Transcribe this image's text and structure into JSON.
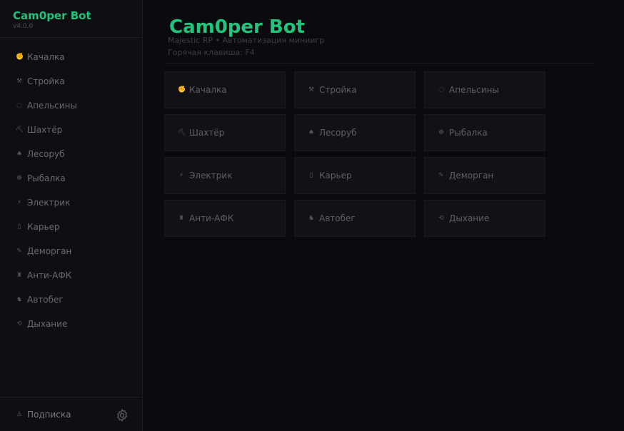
{
  "app": {
    "title": "Cam0per Bot",
    "version": "v4.0.0",
    "accent_color": "#20c47a"
  },
  "sidebar": {
    "items": [
      {
        "label": "Качалка",
        "icon": "muscle-icon",
        "glyph": "✊"
      },
      {
        "label": "Стройка",
        "icon": "hammer-icon",
        "glyph": "⚒"
      },
      {
        "label": "Апельсины",
        "icon": "orange-icon",
        "glyph": "◌"
      },
      {
        "label": "Шахтёр",
        "icon": "pickaxe-icon",
        "glyph": "⛏"
      },
      {
        "label": "Лесоруб",
        "icon": "tree-icon",
        "glyph": "♠"
      },
      {
        "label": "Рыбалка",
        "icon": "fish-icon",
        "glyph": "☸"
      },
      {
        "label": "Электрик",
        "icon": "lightning-icon",
        "glyph": "⚡"
      },
      {
        "label": "Карьер",
        "icon": "quarry-icon",
        "glyph": "▯"
      },
      {
        "label": "Деморган",
        "icon": "pen-icon",
        "glyph": "✎"
      },
      {
        "label": "Анти-АФК",
        "icon": "flask-icon",
        "glyph": "♜"
      },
      {
        "label": "Автобег",
        "icon": "runner-icon",
        "glyph": "♞"
      },
      {
        "label": "Дыхание",
        "icon": "breath-icon",
        "glyph": "⟲"
      }
    ],
    "footer": {
      "subscription_label": "Подписка",
      "subscription_icon": "user-icon",
      "subscription_glyph": "♙",
      "settings_icon": "gear-icon"
    }
  },
  "main": {
    "title": "Cam0per Bot",
    "subtitle": "Majestic RP • Автоматизация миниигр",
    "hotkey": "Горячая клавиша: F4",
    "cards": [
      {
        "label": "Качалка",
        "icon": "muscle-icon",
        "glyph": "✊"
      },
      {
        "label": "Стройка",
        "icon": "hammer-icon",
        "glyph": "⚒"
      },
      {
        "label": "Апельсины",
        "icon": "orange-icon",
        "glyph": "◌"
      },
      {
        "label": "Шахтёр",
        "icon": "pickaxe-icon",
        "glyph": "⛏"
      },
      {
        "label": "Лесоруб",
        "icon": "tree-icon",
        "glyph": "♠"
      },
      {
        "label": "Рыбалка",
        "icon": "fish-icon",
        "glyph": "☸"
      },
      {
        "label": "Электрик",
        "icon": "lightning-icon",
        "glyph": "⚡"
      },
      {
        "label": "Карьер",
        "icon": "quarry-icon",
        "glyph": "▯"
      },
      {
        "label": "Деморган",
        "icon": "pen-icon",
        "glyph": "✎"
      },
      {
        "label": "Анти-АФК",
        "icon": "flask-icon",
        "glyph": "♜"
      },
      {
        "label": "Автобег",
        "icon": "runner-icon",
        "glyph": "♞"
      },
      {
        "label": "Дыхание",
        "icon": "breath-icon",
        "glyph": "⟲"
      }
    ]
  }
}
